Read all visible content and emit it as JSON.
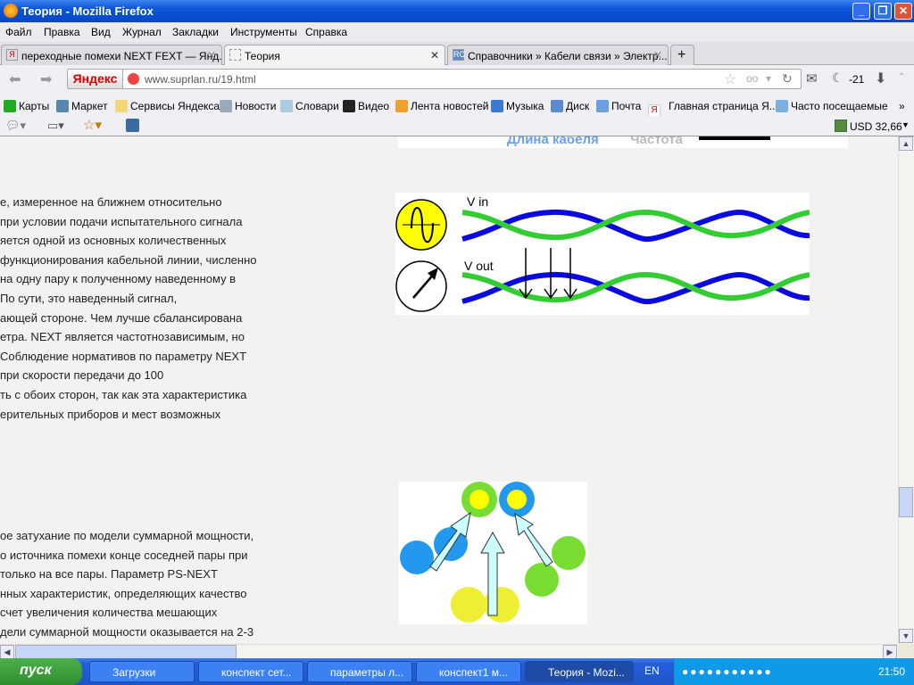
{
  "window": {
    "title": "Теория - Mozilla Firefox"
  },
  "menu": [
    "Файл",
    "Правка",
    "Вид",
    "Журнал",
    "Закладки",
    "Инструменты",
    "Справка"
  ],
  "tabs": [
    {
      "label": "переходные помехи NEXT FEXT — Янд..."
    },
    {
      "label": "Теория"
    },
    {
      "label": "Справочники » Кабели связи » Электр..."
    }
  ],
  "nav": {
    "yandex": "Яндекс",
    "url": "www.suprlan.ru/19.html",
    "counter": "-21"
  },
  "bookmarks": [
    "Карты",
    "Маркет",
    "Сервисы Яндекса",
    "Новости",
    "Словари",
    "Видео",
    "Лента новостей",
    "Музыка",
    "Диск",
    "Почта",
    "Главная страница Я...",
    "Часто посещаемые"
  ],
  "addon": {
    "currency": "USD 32,66"
  },
  "content": {
    "header_image": {
      "length": "Длина кабеля",
      "frequency": "Частота"
    },
    "paragraph1": [
      "е, измеренное на ближнем относительно",
      "при условии подачи испытательного сигнала",
      "яется одной из основных количественных",
      "функционирования кабельной линии, численно",
      "на одну пару к полученному наведенному в",
      "По сути, это наведенный сигнал,",
      "ающей стороне. Чем лучше сбалансирована",
      "етра. NEXT является частотнозависимым, но",
      " Соблюдение нормативов по параметру NEXT",
      "при скорости передачи до 100",
      "ть с обоих сторон, так как эта характеристика",
      "ерительных приборов и мест возможных"
    ],
    "diagram": {
      "vin": "V in",
      "vout": "V out"
    },
    "paragraph2": [
      "ое затухание по модели суммарной мощности,",
      "о источника помехи конце соседней пары при",
      " только на все пары. Параметр PS-NEXT",
      "нных характеристик, определяющих качество",
      " счет увеличения количества мешающих",
      "дели суммарной мощности оказывается на 2-3"
    ]
  },
  "taskbar": {
    "start": "пуск",
    "tasks": [
      "Загрузки",
      "конспект сет...",
      "параметры л...",
      "конспект1 м...",
      "Теория - Mozi..."
    ],
    "lang": "EN",
    "clock": "21:50"
  }
}
